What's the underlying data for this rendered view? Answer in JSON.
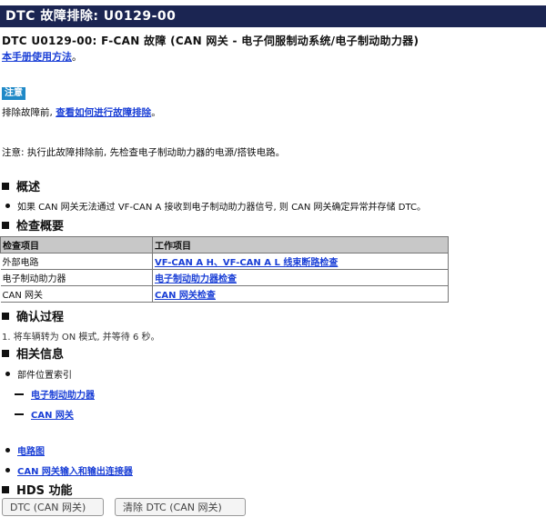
{
  "header": {
    "title": "DTC 故障排除: U0129-00"
  },
  "subtitle": "DTC U0129-00: F-CAN 故障 (CAN 网关 - 电子伺服制动系统/电子制动助力器)",
  "manual_link": "本手册使用方法",
  "note": {
    "badge": "注意",
    "prefix": "排除故障前, ",
    "link": "查看如何进行故障排除",
    "suffix": "。"
  },
  "caution": "注意: 执行此故障排除前, 先检查电子制动助力器的电源/搭铁电路。",
  "overview": {
    "title": "概述",
    "bullet": "如果 CAN 网关无法通过 VF-CAN A 接收到电子制动助力器信号, 则 CAN 网关确定异常并存储 DTC。"
  },
  "check_overview": {
    "title": "检查概要",
    "columns": [
      "检查项目",
      "工作项目"
    ],
    "rows": [
      {
        "item": "外部电路",
        "work": "VF-CAN A H、VF-CAN A L 线束断路检查"
      },
      {
        "item": "电子制动助力器",
        "work": "电子制动助力器检查"
      },
      {
        "item": "CAN 网关",
        "work": "CAN 网关检查"
      }
    ]
  },
  "confirm": {
    "title": "确认过程",
    "step": "1. 将车辆转为 ON 模式, 并等待 6 秒。"
  },
  "related": {
    "title": "相关信息",
    "parts_index": "部件位置索引",
    "sub_links": [
      "电子制动助力器",
      "CAN 网关"
    ],
    "circuit": "电路图",
    "connector": "CAN 网关输入和输出连接器"
  },
  "hds": {
    "title": "HDS 功能",
    "buttons": [
      "DTC (CAN 网关)",
      "清除 DTC (CAN 网关)"
    ]
  }
}
